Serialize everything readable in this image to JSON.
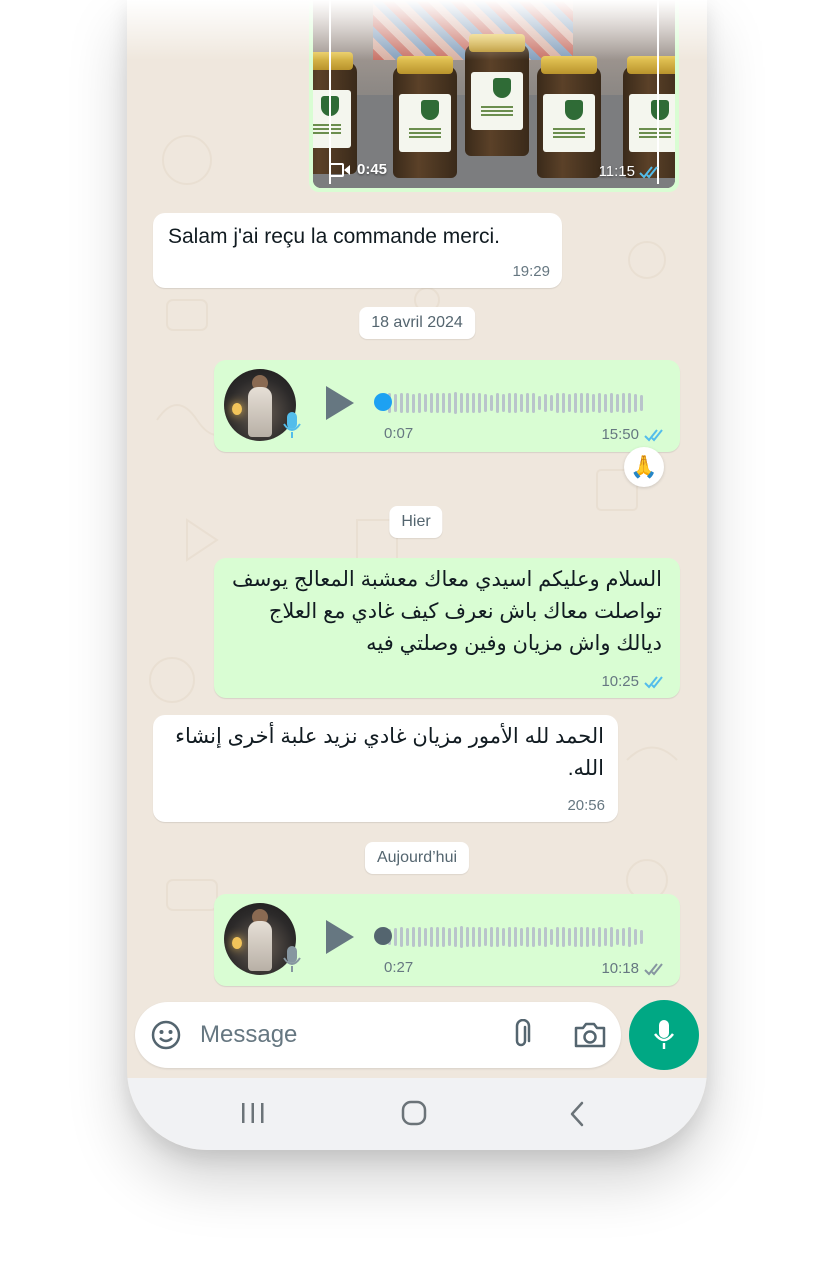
{
  "colors": {
    "chat_bg": "#efe7dd",
    "outgoing_bubble": "#d9fdd3",
    "incoming_bubble": "#ffffff",
    "read_ticks": "#53bdeb",
    "unread_ticks": "#8696a0",
    "accent": "#00a884"
  },
  "video_message": {
    "duration": "0:45",
    "time": "11:15",
    "status_icon": "double-check-read-icon"
  },
  "messages": [
    {
      "direction": "in",
      "text": "Salam j'ai reçu la commande merci.",
      "time": "19:29"
    },
    {
      "direction": "out",
      "type": "voice",
      "duration": "0:07",
      "time": "15:50",
      "status_icon": "double-check-read-icon",
      "reaction": "🙏",
      "progress": 0
    },
    {
      "direction": "out",
      "text_lines": [
        "السلام وعليكم اسيدي  معاك معشبة المعالج يوسف",
        "تواصلت معاك باش نعرف كيف غادي مع العلاج",
        "ديالك واش مزيان وفين وصلتي  فيه"
      ],
      "time": "10:25",
      "status_icon": "double-check-read-icon"
    },
    {
      "direction": "in",
      "text_lines": [
        "الحمد لله الأمور مزيان غادي نزيد علبة أخرى إنشاء",
        "الله."
      ],
      "time": "20:56"
    },
    {
      "direction": "out",
      "type": "voice",
      "duration": "0:27",
      "time": "10:18",
      "status_icon": "double-check-delivered-icon",
      "progress": 0
    }
  ],
  "date_separators": [
    "18 avril 2024",
    "Hier",
    "Aujourd’hui"
  ],
  "composer": {
    "placeholder": "Message"
  }
}
